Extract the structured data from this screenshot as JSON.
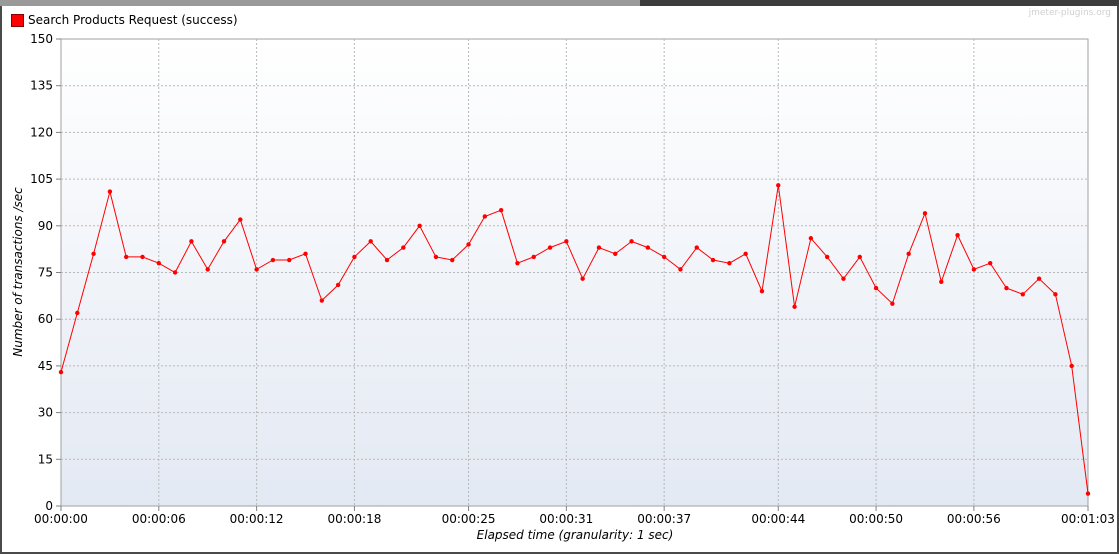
{
  "chart_data": {
    "type": "line",
    "legend": {
      "label": "Search Products Request (success)",
      "color": "#ff0000",
      "position": "top-left"
    },
    "watermark": "jmeter-plugins.org",
    "xlabel": "Elapsed time (granularity: 1 sec)",
    "ylabel": "Number of transactions /sec",
    "ylim": [
      0,
      150
    ],
    "yticks": [
      "0",
      "15",
      "30",
      "45",
      "60",
      "75",
      "90",
      "105",
      "120",
      "135",
      "150"
    ],
    "xlim": [
      0,
      63
    ],
    "xticks": [
      {
        "t": 0,
        "label": "00:00:00"
      },
      {
        "t": 6,
        "label": "00:00:06"
      },
      {
        "t": 12,
        "label": "00:00:12"
      },
      {
        "t": 18,
        "label": "00:00:18"
      },
      {
        "t": 25,
        "label": "00:00:25"
      },
      {
        "t": 31,
        "label": "00:00:31"
      },
      {
        "t": 37,
        "label": "00:00:37"
      },
      {
        "t": 44,
        "label": "00:00:44"
      },
      {
        "t": 50,
        "label": "00:00:50"
      },
      {
        "t": 56,
        "label": "00:00:56"
      },
      {
        "t": 63,
        "label": "00:01:03"
      }
    ],
    "grid": true,
    "series": [
      {
        "name": "Search Products Request (success)",
        "color": "#ff0000",
        "x": [
          0,
          1,
          2,
          3,
          4,
          5,
          6,
          7,
          8,
          9,
          10,
          11,
          12,
          13,
          14,
          15,
          16,
          17,
          18,
          19,
          20,
          21,
          22,
          23,
          24,
          25,
          26,
          27,
          28,
          29,
          30,
          31,
          32,
          33,
          34,
          35,
          36,
          37,
          38,
          39,
          40,
          41,
          42,
          43,
          44,
          45,
          46,
          47,
          48,
          49,
          50,
          51,
          52,
          53,
          54,
          55,
          56,
          57,
          58,
          59,
          60,
          61,
          62,
          63
        ],
        "values": [
          43,
          62,
          81,
          101,
          80,
          80,
          78,
          75,
          85,
          76,
          85,
          92,
          76,
          79,
          79,
          81,
          66,
          71,
          80,
          85,
          79,
          83,
          90,
          80,
          79,
          84,
          93,
          95,
          78,
          80,
          83,
          85,
          73,
          83,
          81,
          85,
          83,
          80,
          76,
          83,
          79,
          78,
          81,
          69,
          103,
          64,
          86,
          80,
          73,
          80,
          70,
          65,
          81,
          94,
          72,
          87,
          76,
          78,
          70,
          68,
          73,
          68,
          45,
          4
        ]
      }
    ]
  }
}
